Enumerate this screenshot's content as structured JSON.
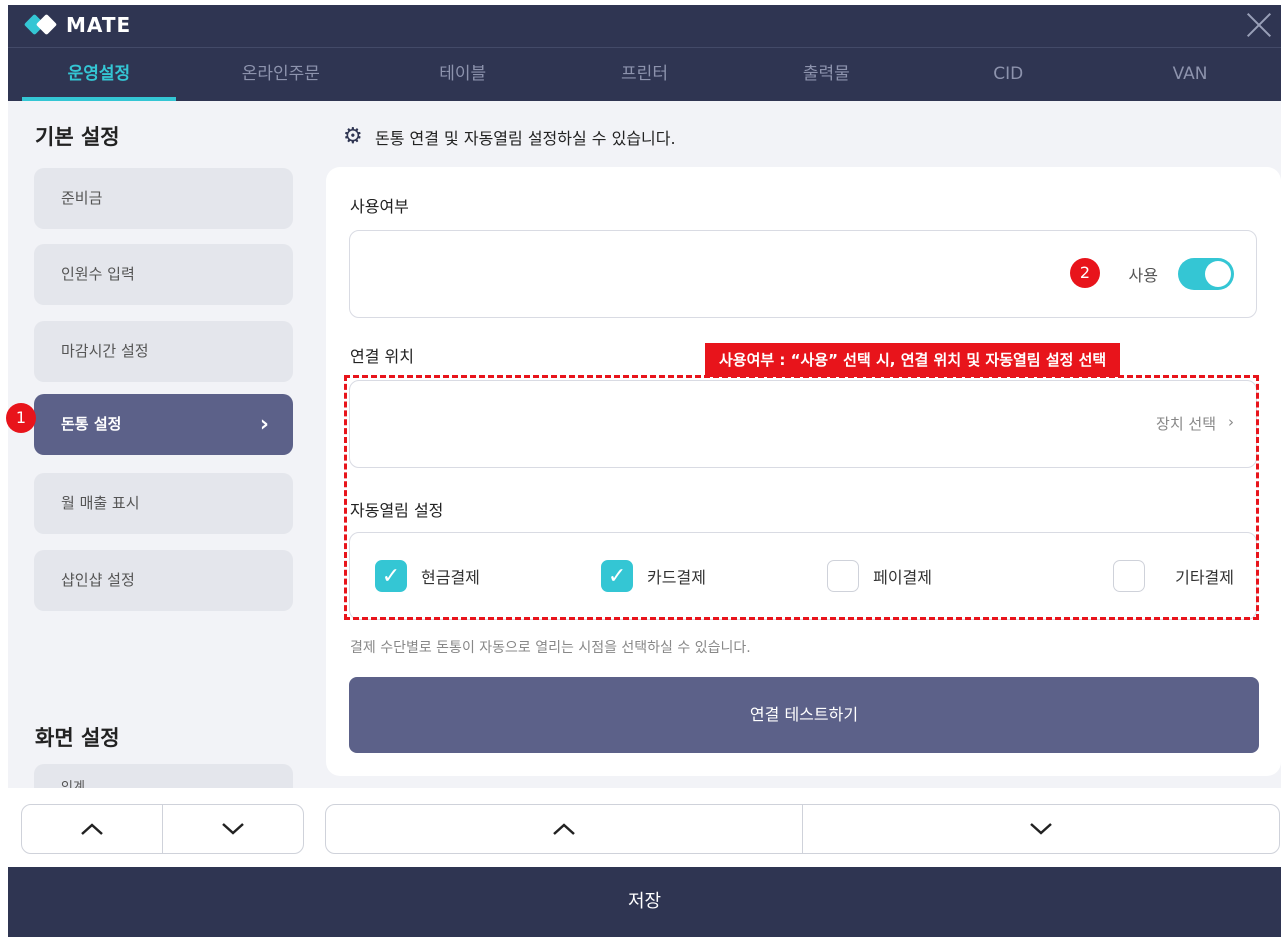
{
  "app": {
    "logo_text": "MATE"
  },
  "tabs": [
    {
      "label": "운영설정",
      "active": true
    },
    {
      "label": "온라인주문"
    },
    {
      "label": "테이블"
    },
    {
      "label": "프린터"
    },
    {
      "label": "출력물"
    },
    {
      "label": "CID"
    },
    {
      "label": "VAN"
    }
  ],
  "sidebar": {
    "basic_title": "기본 설정",
    "items": [
      {
        "label": "준비금"
      },
      {
        "label": "인원수 입력"
      },
      {
        "label": "마감시간 설정"
      },
      {
        "label": "돈통 설정",
        "active": true
      },
      {
        "label": "월 매출 표시"
      },
      {
        "label": "샵인샵 설정"
      }
    ],
    "screen_title": "화면 설정",
    "partial_item": "인계"
  },
  "main": {
    "header": "돈통 연결 및 자동열림 설정하실 수 있습니다.",
    "usage_label": "사용여부",
    "usage_value": "사용",
    "location_label": "연결 위치",
    "device_select": "장치 선택",
    "auto_open_label": "자동열림 설정",
    "payments": [
      {
        "label": "현금결제",
        "checked": true
      },
      {
        "label": "카드결제",
        "checked": true
      },
      {
        "label": "페이결제",
        "checked": false
      },
      {
        "label": "기타결제",
        "checked": false
      }
    ],
    "hint": "결제 수단별로 돈통이 자동으로 열리는 시점을 선택하실 수 있습니다.",
    "test_button": "연결 테스트하기"
  },
  "annotations": {
    "marker1": "1",
    "marker2": "2",
    "callout": "사용여부 : “사용” 선택 시,  연결 위치 및 자동열림 설정 선택"
  },
  "footer": {
    "save": "저장"
  },
  "colors": {
    "navy": "#2f3552",
    "accent": "#34c6d4",
    "active_item": "#5c6189",
    "annotation": "#e8141b"
  }
}
